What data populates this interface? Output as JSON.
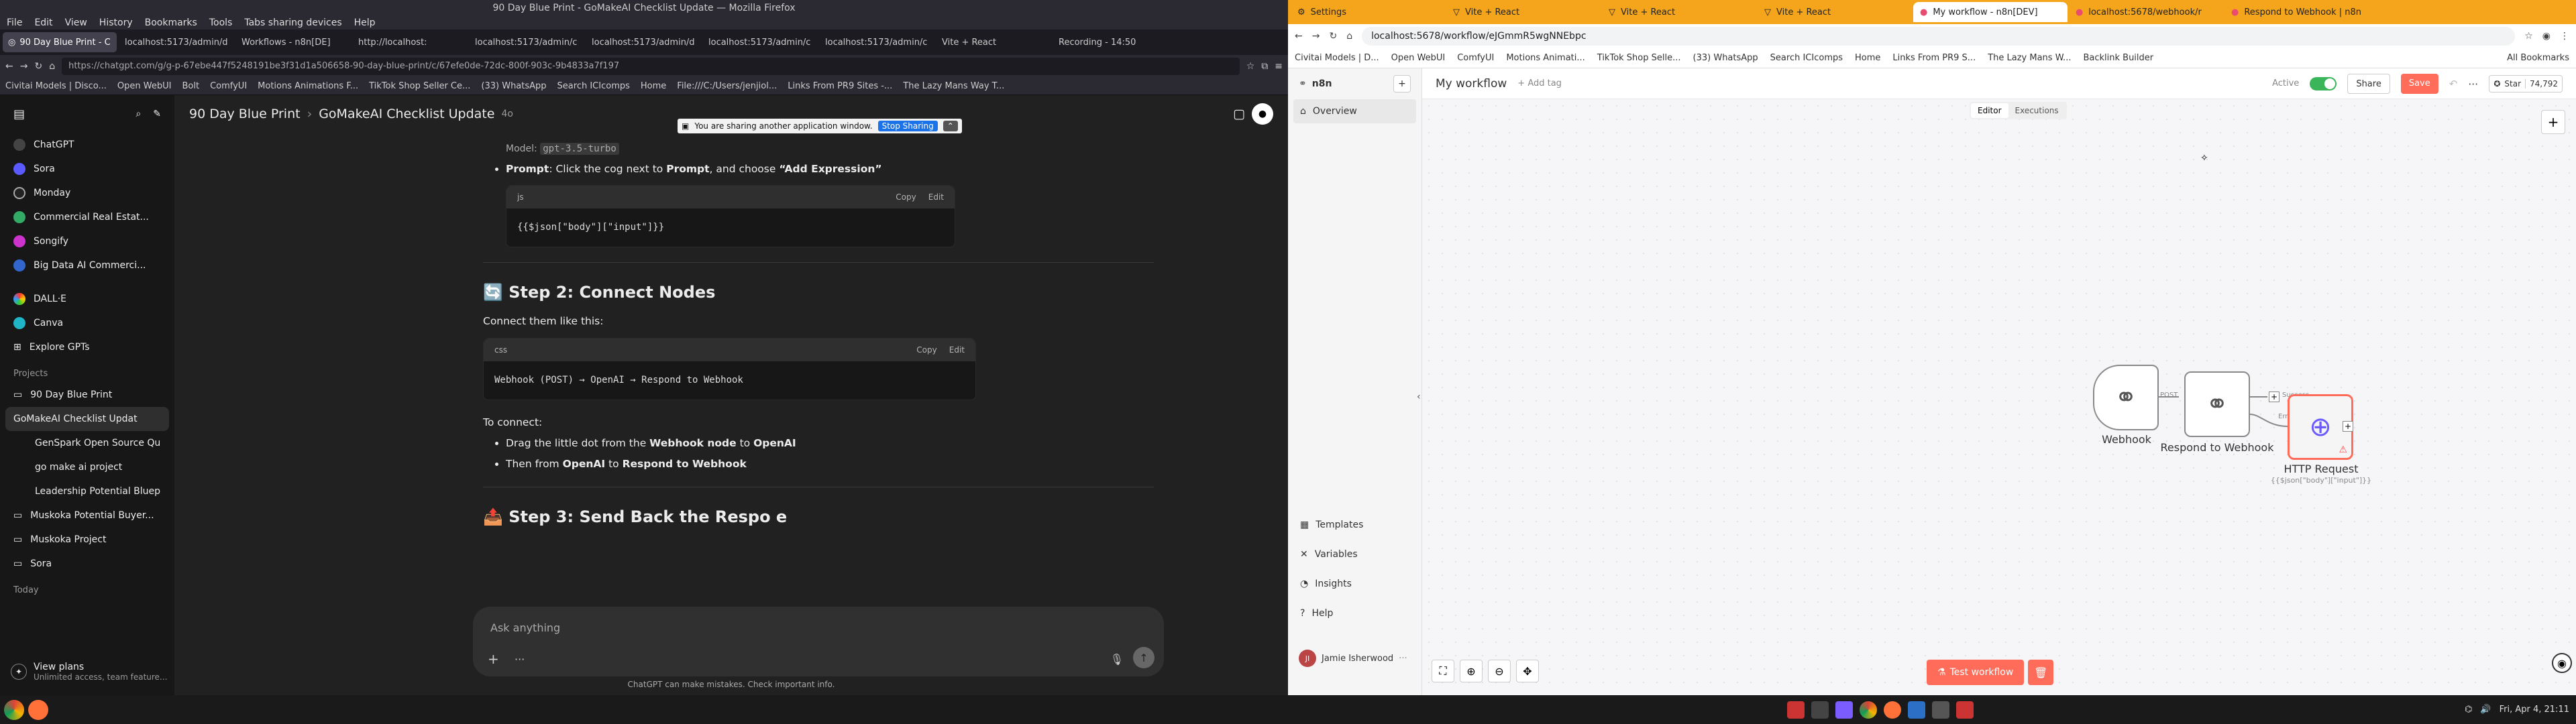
{
  "firefox": {
    "title": "90 Day Blue Print - GoMakeAI Checklist Update — Mozilla Firefox",
    "menu": [
      "File",
      "Edit",
      "View",
      "History",
      "Bookmarks",
      "Tools",
      "Tabs sharing devices",
      "Help"
    ],
    "tabs": [
      "90 Day Blue Print - C",
      "localhost:5173/admin/d",
      "Workflows - n8n[DE]",
      "http://localhost:",
      "localhost:5173/admin/c",
      "localhost:5173/admin/d",
      "localhost:5173/admin/c",
      "localhost:5173/admin/c",
      "Vite + React",
      "Recording - 14:50"
    ],
    "url": "https://chatgpt.com/g/g-p-67ebe447f5248191be3f31d1a506658-90-day-blue-print/c/67efe0de-72dc-800f-903c-9b4833a7f197",
    "bookmarks": [
      "Civitai Models | Disco...",
      "Open WebUI",
      "Bolt",
      "ComfyUI",
      "Motions Animations F...",
      "TikTok Shop Seller Ce...",
      "(33) WhatsApp",
      "Search ICIcomps",
      "Home",
      "File:///C:/Users/jenjiol...",
      "Links From PR9 Sites -...",
      "The Lazy Mans Way T..."
    ]
  },
  "share_banner": {
    "text": "You are sharing another application window.",
    "button": "Stop Sharing"
  },
  "chatgpt": {
    "header": {
      "project": "90 Day Blue Print",
      "chat": "GoMakeAI Checklist Update",
      "model": "4o"
    },
    "sidebar": {
      "top": [
        "ChatGPT",
        "Sora",
        "Monday",
        "Commercial Real Estat...",
        "Songify",
        "Big Data AI Commerci..."
      ],
      "gpts": [
        "DALL·E",
        "Canva",
        "Explore GPTs"
      ],
      "projects_label": "Projects",
      "projects": [
        "90 Day Blue Print",
        "GoMakeAI Checklist Updat",
        "GenSpark Open Source Qu",
        "go make ai project",
        "Leadership Potential Bluep",
        "Muskoka Potential Buyer...",
        "Muskoka Project",
        "Sora"
      ],
      "today_label": "Today",
      "view_plans": "View plans",
      "view_plans_sub": "Unlimited access, team feature..."
    },
    "content": {
      "model_line": "Model:",
      "model_chip": "gpt-3.5-turbo",
      "prompt_bold": "Prompt",
      "prompt_text": ": Click the cog next to ",
      "prompt_bold2": "Prompt",
      "prompt_text2": ", and choose ",
      "prompt_quote": "“Add Expression”",
      "code1_lang": "js",
      "code1": "{{$json[\"body\"][\"input\"]}}",
      "copy": "Copy",
      "edit": "Edit",
      "step2": "🔄 Step 2: Connect Nodes",
      "connect_intro": "Connect them like this:",
      "code2_lang": "css",
      "code2": "Webhook (POST) → OpenAI → Respond to Webhook",
      "to_connect": "To connect:",
      "bullet1_a": "Drag the little dot from the ",
      "bullet1_b": "Webhook node",
      "bullet1_c": " to ",
      "bullet1_d": "OpenAI",
      "bullet2_a": "Then from ",
      "bullet2_b": "OpenAI",
      "bullet2_c": " to ",
      "bullet2_d": "Respond to Webhook",
      "step3": "📤 Step 3: Send Back the Respo  e"
    },
    "input_placeholder": "Ask anything",
    "footer": "ChatGPT can make mistakes. Check important info."
  },
  "chrome": {
    "tabs": [
      "Settings",
      "Vite + React",
      "Vite + React",
      "Vite + React",
      "My workflow - n8n[DEV]",
      "localhost:5678/webhook/r",
      "Respond to Webhook | n8n"
    ],
    "url": "localhost:5678/workflow/eJGmmR5wgNNEbpc",
    "bookmarks": [
      "Civitai Models | D...",
      "Open WebUI",
      "ComfyUI",
      "Motions Animati...",
      "TikTok Shop Selle...",
      "(33) WhatsApp",
      "Search ICIcomps",
      "Home",
      "Links From PR9 S...",
      "The Lazy Mans W...",
      "Backlink Builder",
      "All Bookmarks"
    ]
  },
  "n8n": {
    "brand": "n8n",
    "overview": "Overview",
    "workflow_name": "My workflow",
    "add_tag": "+ Add tag",
    "active_label": "Active",
    "share": "Share",
    "save": "Save",
    "star": "Star",
    "star_count": "74,792",
    "tabs": [
      "Editor",
      "Executions"
    ],
    "sidebar_bottom": [
      "Templates",
      "Variables",
      "Insights",
      "Help"
    ],
    "user": "Jamie Isherwood",
    "nodes": [
      {
        "label": "Webhook",
        "sub": ""
      },
      {
        "label": "Respond to Webhook",
        "sub": ""
      },
      {
        "label": "HTTP Request",
        "sub": "{{$json[\"body\"][\"input\"]}}"
      }
    ],
    "edge_labels": [
      "POST",
      "Success",
      "Error"
    ],
    "test_workflow": "Test workflow"
  },
  "taskbar": {
    "datetime": "Fri, Apr 4, 21:11"
  }
}
